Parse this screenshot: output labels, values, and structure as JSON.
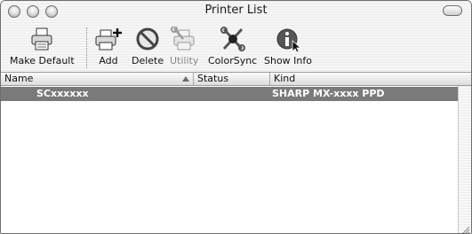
{
  "window": {
    "title": "Printer List"
  },
  "toolbar": {
    "make_default": "Make Default",
    "add": "Add",
    "delete": "Delete",
    "utility": "Utility",
    "colorsync": "ColorSync",
    "show_info": "Show Info"
  },
  "table": {
    "columns": [
      "Name",
      "Status",
      "Kind"
    ],
    "rows": [
      {
        "name": "SCxxxxxx",
        "status": "",
        "kind": "SHARP MX-xxxx PPD"
      }
    ]
  },
  "icons": {
    "make_default": "printer-icon",
    "add": "printer-add-icon",
    "delete": "delete-icon",
    "utility": "utility-icon",
    "colorsync": "colorsync-icon",
    "show_info": "info-icon"
  },
  "colors": {
    "selection": "#7a7a7a",
    "window_border": "#6f6f6f"
  }
}
